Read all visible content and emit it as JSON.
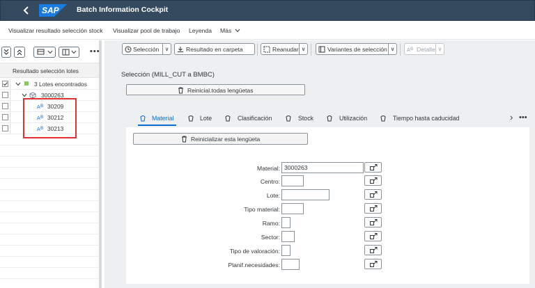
{
  "shell": {
    "title": "Batch Information Cockpit",
    "logo_text": "SAP",
    "back_icon": "chevron-left-icon",
    "bar_color": "#354a5f"
  },
  "app_toolbar": {
    "items": [
      "Visualizar resultado selección stock",
      "Visualizar pool de trabajo",
      "Leyenda",
      "Más"
    ],
    "more_icon": "chevron-down-icon"
  },
  "left_pane": {
    "more_label": "•••",
    "header": "Resultado selección lotes",
    "tree": {
      "root_label": "3 Lotes encontrados",
      "material_label": "3000263",
      "batches": [
        "30209",
        "30212",
        "30213"
      ]
    },
    "highlight_color": "#e0302f"
  },
  "main_toolbar": {
    "buttons": [
      "Selección",
      "Resultado en carpeta",
      "Reanudar",
      "Variantes de selección",
      "Detalle"
    ]
  },
  "selection": {
    "title": "Selección (MILL_CUT a BMBC)",
    "reset_all_label": "Reinicial.todas lengüetas"
  },
  "tabs": {
    "items": [
      "Material",
      "Lote",
      "Clasificación",
      "Stock",
      "Utilización",
      "Tiempo hasta caducidad"
    ],
    "active": "Material",
    "accent_color": "#0a6ed1",
    "more_label": "•••"
  },
  "material_tab": {
    "reset_label": "Reinicializar esta lengüeta",
    "fields": [
      {
        "label": "Material:",
        "value": "3000263"
      },
      {
        "label": "Centro:",
        "value": ""
      },
      {
        "label": "Lote:",
        "value": ""
      },
      {
        "label": "Tipo material:",
        "value": ""
      },
      {
        "label": "Ramo:",
        "value": ""
      },
      {
        "label": "Sector:",
        "value": ""
      },
      {
        "label": "Tipo de valoración:",
        "value": ""
      },
      {
        "label": "Planif.necesidades:",
        "value": ""
      }
    ],
    "multiple_selection_icon": "arrow-up-right-icon"
  }
}
